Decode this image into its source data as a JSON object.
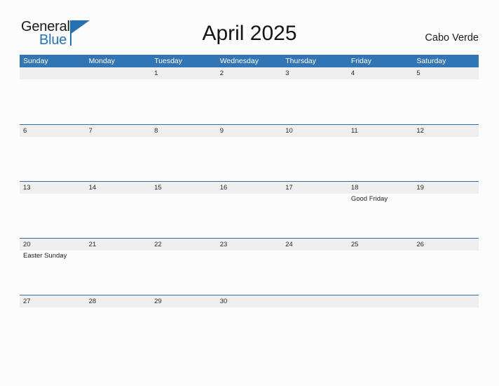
{
  "brand": {
    "name_part1": "General",
    "name_part2": "Blue",
    "triangle_color": "#2471b3"
  },
  "header": {
    "title": "April 2025",
    "country": "Cabo Verde"
  },
  "calendar": {
    "accent_color": "#3275b5",
    "band_color": "#efefef",
    "rule_color": "#2b6fac",
    "weekday_headers": [
      "Sunday",
      "Monday",
      "Tuesday",
      "Wednesday",
      "Thursday",
      "Friday",
      "Saturday"
    ],
    "weeks": [
      [
        {
          "day": "",
          "events": []
        },
        {
          "day": "",
          "events": []
        },
        {
          "day": "1",
          "events": []
        },
        {
          "day": "2",
          "events": []
        },
        {
          "day": "3",
          "events": []
        },
        {
          "day": "4",
          "events": []
        },
        {
          "day": "5",
          "events": []
        }
      ],
      [
        {
          "day": "6",
          "events": []
        },
        {
          "day": "7",
          "events": []
        },
        {
          "day": "8",
          "events": []
        },
        {
          "day": "9",
          "events": []
        },
        {
          "day": "10",
          "events": []
        },
        {
          "day": "11",
          "events": []
        },
        {
          "day": "12",
          "events": []
        }
      ],
      [
        {
          "day": "13",
          "events": []
        },
        {
          "day": "14",
          "events": []
        },
        {
          "day": "15",
          "events": []
        },
        {
          "day": "16",
          "events": []
        },
        {
          "day": "17",
          "events": []
        },
        {
          "day": "18",
          "events": [
            "Good Friday"
          ]
        },
        {
          "day": "19",
          "events": []
        }
      ],
      [
        {
          "day": "20",
          "events": [
            "Easter Sunday"
          ]
        },
        {
          "day": "21",
          "events": []
        },
        {
          "day": "22",
          "events": []
        },
        {
          "day": "23",
          "events": []
        },
        {
          "day": "24",
          "events": []
        },
        {
          "day": "25",
          "events": []
        },
        {
          "day": "26",
          "events": []
        }
      ],
      [
        {
          "day": "27",
          "events": []
        },
        {
          "day": "28",
          "events": []
        },
        {
          "day": "29",
          "events": []
        },
        {
          "day": "30",
          "events": []
        },
        {
          "day": "",
          "events": []
        },
        {
          "day": "",
          "events": []
        },
        {
          "day": "",
          "events": []
        }
      ]
    ]
  }
}
